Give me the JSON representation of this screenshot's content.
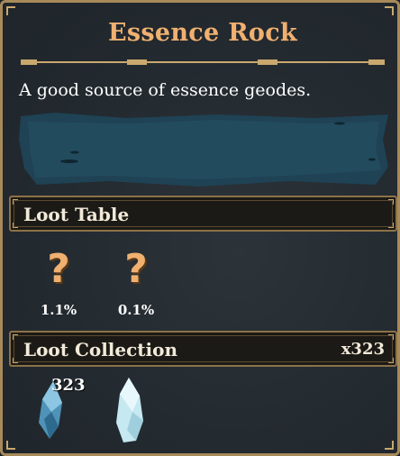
{
  "window": {
    "title": "Essence Rock",
    "description": "A good source of essence geodes."
  },
  "loot_table": {
    "label": "Loot Table",
    "items": [
      {
        "icon": "question-mark-icon",
        "glyph": "?",
        "chance": "1.1%"
      },
      {
        "icon": "question-mark-icon",
        "glyph": "?",
        "chance": "0.1%"
      }
    ]
  },
  "loot_collection": {
    "label": "Loot Collection",
    "total": "x323",
    "items": [
      {
        "icon": "blue-crystal-icon",
        "count": "323"
      },
      {
        "icon": "white-crystal-icon",
        "count": ""
      }
    ]
  },
  "colors": {
    "title": "#f0b070",
    "border": "#a88a5a",
    "panel_bg": "#232a30",
    "header_bg": "#1c1a16"
  }
}
